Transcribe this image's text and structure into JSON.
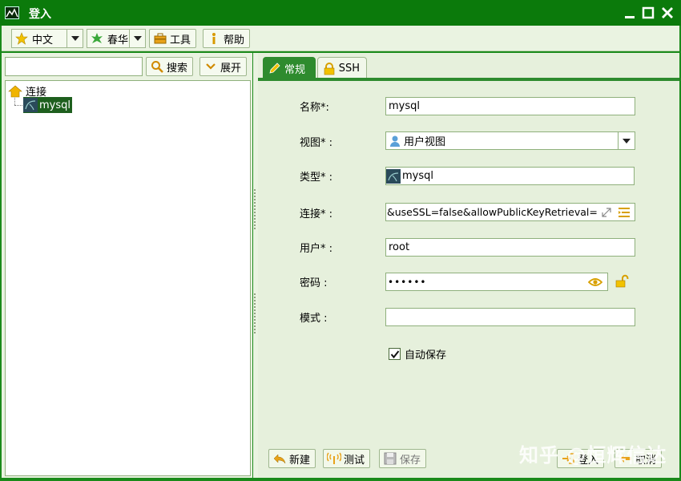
{
  "window": {
    "title": "登入"
  },
  "toolbar": {
    "language": "中文",
    "theme": "春华",
    "tools_label": "工具",
    "help_label": "帮助"
  },
  "left": {
    "search_value": "",
    "search_button": "搜索",
    "expand_button": "展开",
    "tree": {
      "root": "连接",
      "child": "mysql"
    }
  },
  "tabs": [
    {
      "label": "常规",
      "active": true
    },
    {
      "label": "SSH",
      "active": false
    }
  ],
  "form": {
    "name_label": "名称*:",
    "name_value": "mysql",
    "view_label": "视图* :",
    "view_value": "用户视图",
    "type_label": "类型* :",
    "type_value": "mysql",
    "conn_label": "连接* :",
    "conn_value": "&useSSL=false&allowPublicKeyRetrieval=true",
    "user_label": "用户* :",
    "user_value": "root",
    "password_label": "密码 :",
    "password_value": "••••••",
    "schema_label": "模式 :",
    "schema_value": "",
    "autosave_label": "自动保存",
    "autosave_checked": true
  },
  "buttons": {
    "new": "新建",
    "test": "测试",
    "save": "保存",
    "login": "登入",
    "cancel": "取消"
  },
  "watermark": "知乎 @恒辉信达",
  "icons": {
    "app": "mountain-icon",
    "language": "star-icon",
    "theme": "leaf-icon",
    "tools": "toolbox-icon",
    "help": "info-icon",
    "search": "search-icon",
    "expand": "chevron-down-icon",
    "tree_root": "home-icon",
    "tree_child": "mysql-icon",
    "tab_general": "pencil-icon",
    "tab_ssh": "lock-icon",
    "view": "user-icon",
    "expand_field": "expand-icon",
    "list": "list-icon",
    "eye": "eye-icon",
    "unlock": "unlock-icon",
    "new": "undo-arrow-icon",
    "test": "antenna-icon",
    "save": "floppy-icon",
    "login": "login-icon",
    "cancel": "cancel-icon"
  },
  "colors": {
    "titlebar": "#0b7a0b",
    "accent": "#2e8b2e",
    "panel": "#eaf3e1",
    "selection": "#1e5f1e"
  }
}
